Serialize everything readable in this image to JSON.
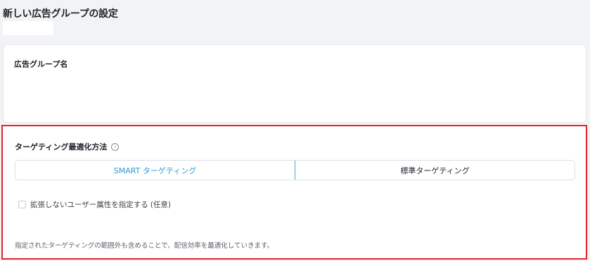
{
  "page": {
    "title": "新しい広告グループの設定"
  },
  "ad_group_name": {
    "label": "広告グループ名"
  },
  "targeting": {
    "title": "ターゲティング最適化方法",
    "info_icon": "info-icon",
    "options": [
      {
        "label": "SMART ターゲティング",
        "selected": true
      },
      {
        "label": "標準ターゲティング",
        "selected": false
      }
    ],
    "checkbox_label": "拡張しないユーザー属性を指定する",
    "checkbox_optional": "(任意)",
    "checkbox_checked": false,
    "helper_text": "指定されたターゲティングの範囲外も含めることで、配信効率を最適化していきます。"
  },
  "colors": {
    "highlight_border": "#e3222d",
    "accent": "#2d9bd3",
    "page_background": "#f2f3f5"
  }
}
